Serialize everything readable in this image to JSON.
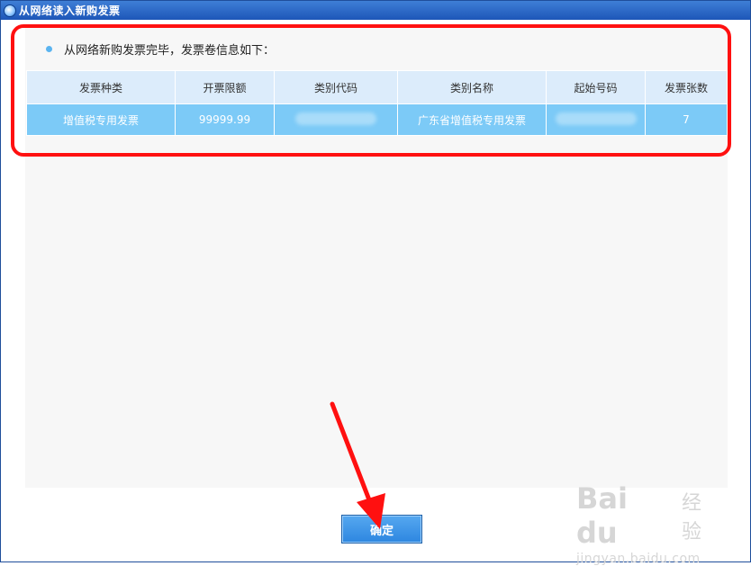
{
  "window": {
    "title": "从网络读入新购发票",
    "icon": "app-globe-icon"
  },
  "message": "从网络新购发票完毕，发票卷信息如下：",
  "table": {
    "headers": [
      "发票种类",
      "开票限额",
      "类别代码",
      "类别名称",
      "起始号码",
      "发票张数"
    ],
    "rows": [
      [
        "增值税专用发票",
        "99999.99",
        "",
        "广东省增值税专用发票",
        "",
        "7"
      ]
    ]
  },
  "buttons": {
    "ok_label": "确定"
  },
  "watermark": {
    "logo": "Bai du",
    "cn": "经验",
    "url": "jingyan.baidu.com"
  },
  "colors": {
    "header_bg": "#dcecfb",
    "row_bg": "#7ccaf7",
    "annotation_red": "#ff1010",
    "button_blue": "#3f96e8"
  }
}
